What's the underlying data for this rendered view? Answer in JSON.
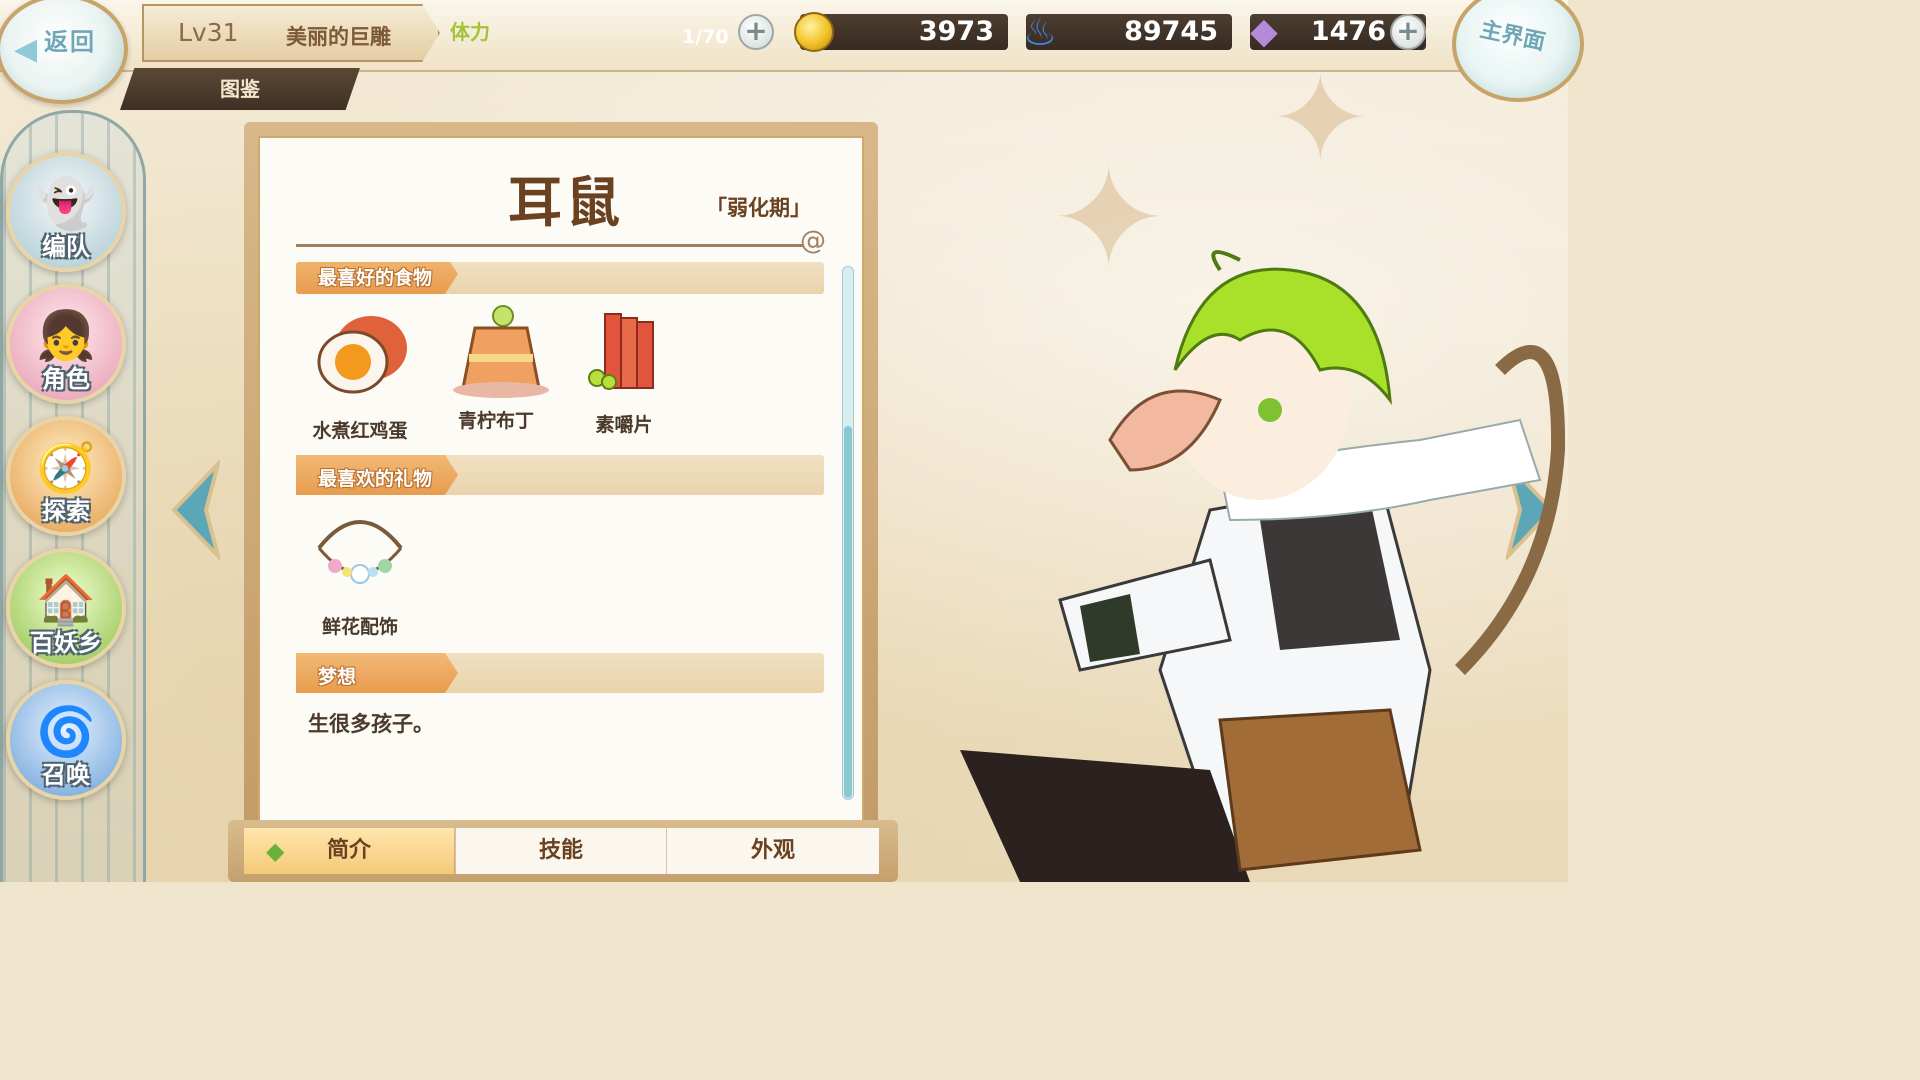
{
  "header": {
    "back_label": "返回",
    "level": "Lv31",
    "player_name": "美丽的巨雕",
    "sub_tab": "图鉴",
    "stamina_label": "体力",
    "stamina_value": "1/70",
    "stamina_fraction": 0.014,
    "coins": "3973",
    "soul_fire": "89745",
    "gems": "1476",
    "home_label": "主界面"
  },
  "sidebar": {
    "items": [
      {
        "label": "编队",
        "icon": "ghost-knight-icon"
      },
      {
        "label": "角色",
        "icon": "girl-portrait-icon"
      },
      {
        "label": "探索",
        "icon": "scroll-compass-icon"
      },
      {
        "label": "百妖乡",
        "icon": "village-icon"
      },
      {
        "label": "召唤",
        "icon": "swirl-icon"
      }
    ]
  },
  "profile": {
    "name": "耳鼠",
    "stage": "「弱化期」",
    "sections": {
      "food_title": "最喜好的食物",
      "gift_title": "最喜欢的礼物",
      "dream_title": "梦想"
    },
    "foods": [
      "水煮红鸡蛋",
      "青柠布丁",
      "素嚼片"
    ],
    "gifts": [
      "鲜花配饰"
    ],
    "dream": "生很多孩子。"
  },
  "tabs": [
    "简介",
    "技能",
    "外观"
  ],
  "colors": {
    "accent_orange": "#e79c4e",
    "text_brown": "#6b4220",
    "hair_green": "#a8e02a"
  }
}
